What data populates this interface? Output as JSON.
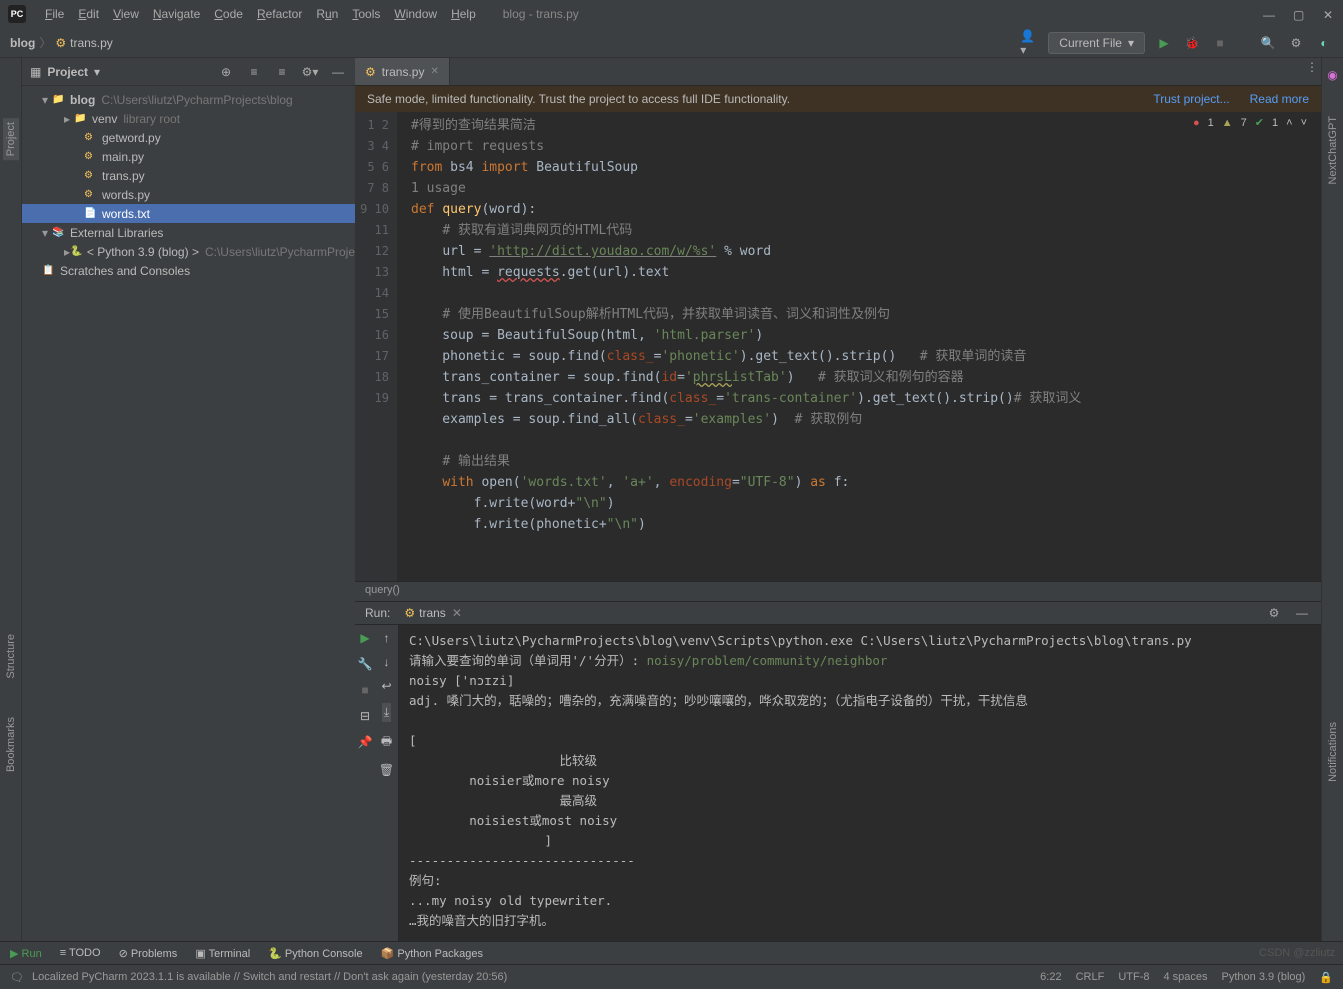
{
  "window": {
    "title": "blog - trans.py"
  },
  "menu": {
    "file": "File",
    "edit": "Edit",
    "view": "View",
    "navigate": "Navigate",
    "code": "Code",
    "refactor": "Refactor",
    "run": "Run",
    "tools": "Tools",
    "window": "Window",
    "help": "Help"
  },
  "breadcrumb": {
    "root": "blog",
    "file": "trans.py"
  },
  "runConfig": {
    "label": "Current File"
  },
  "projectPanel": {
    "title": "Project",
    "root": {
      "name": "blog",
      "path": "C:\\Users\\liutz\\PycharmProjects\\blog"
    },
    "venv": {
      "name": "venv",
      "hint": "library root"
    },
    "files": [
      "getword.py",
      "main.py",
      "trans.py",
      "words.py",
      "words.txt"
    ],
    "extLib": "External Libraries",
    "python": {
      "name": "< Python 3.9 (blog) >",
      "path": "C:\\Users\\liutz\\PycharmProje"
    },
    "scratches": "Scratches and Consoles"
  },
  "tab": {
    "name": "trans.py"
  },
  "banner": {
    "msg": "Safe mode, limited functionality. Trust the project to access full IDE functionality.",
    "trust": "Trust project...",
    "more": "Read more"
  },
  "inspections": {
    "errors": "1",
    "warnings": "7",
    "ok": "1"
  },
  "code": {
    "usage": "1 usage",
    "lines": [
      "1",
      "2",
      "3",
      "4",
      "5",
      "6",
      "7",
      "8",
      "9",
      "10",
      "11",
      "12",
      "13",
      "14",
      "15",
      "16",
      "17",
      "18",
      "19"
    ],
    "l1": "#得到的查询结果简洁",
    "l2": "# import requests",
    "l3_from": "from",
    "l3_bs4": "bs4",
    "l3_import": "import",
    "l3_bsoup": "BeautifulSoup",
    "l4_def": "def",
    "l4_fn": "query",
    "l4_param": "word",
    "l5": "# 获取有道词典网页的HTML代码",
    "l6_url": "url = ",
    "l6_str": "'http://dict.youdao.com/w/%s'",
    "l6_end": " % word",
    "l7": "html = requests.get(url).text",
    "l9": "# 使用BeautifulSoup解析HTML代码，并获取单词读音、词义和词性及例句",
    "l10": "soup = BeautifulSoup(html, 'html.parser')",
    "l11a": "phonetic = soup.find(",
    "l11b": "class_",
    "l11c": "='phonetic').get_text().strip()",
    "l11d": "   # 获取单词的读音",
    "l12a": "trans_container = soup.find(",
    "l12b": "id",
    "l12c": "='phrsListTab')",
    "l12d": "   # 获取词义和例句的容器",
    "l13a": "trans = trans_container.find(",
    "l13b": "class_",
    "l13c": "='trans-container').get_text().strip()",
    "l13d": "# 获取词义",
    "l14a": "examples = soup.find_all(",
    "l14b": "class_",
    "l14c": "='examples')",
    "l14d": "  # 获取例句",
    "l16": "# 输出结果",
    "l17a": "with",
    "l17b": "open",
    "l17c": "('words.txt', 'a+', ",
    "l17d": "encoding",
    "l17e": "=\"UTF-8\") ",
    "l17f": "as",
    "l17g": " f:",
    "l18": "f.write(word+\"\\n\")",
    "l19": "f.write(phonetic+\"\\n\")"
  },
  "breadcrumbBottom": "query()",
  "run": {
    "label": "Run:",
    "tab": "trans",
    "out1": "C:\\Users\\liutz\\PycharmProjects\\blog\\venv\\Scripts\\python.exe C:\\Users\\liutz\\PycharmProjects\\blog\\trans.py",
    "out2": "请输入要查询的单词（单词用'/'分开）: ",
    "out2b": "noisy/problem/community/neighbor",
    "out3": "noisy ['nɔɪzi]",
    "out4": "adj. 嗓门大的，聒噪的；嘈杂的，充满噪音的；吵吵嚷嚷的，哗众取宠的；（尤指电子设备的）干扰，干扰信息",
    "out5": "[",
    "out6": "                    比较级",
    "out7": "        noisier或more noisy",
    "out8": "                    最高级",
    "out9": "        noisiest或most noisy",
    "out10": "                  ]",
    "out11": "------------------------------",
    "out12": "例句:",
    "out13": "...my noisy old typewriter.",
    "out14": "…我的噪音大的旧打字机。"
  },
  "tools": {
    "run": "Run",
    "todo": "TODO",
    "problems": "Problems",
    "terminal": "Terminal",
    "pyconsole": "Python Console",
    "packages": "Python Packages"
  },
  "status": {
    "msg": "Localized PyCharm 2023.1.1 is available // Switch and restart // Don't ask again (yesterday 20:56)",
    "pos": "6:22",
    "eol": "CRLF",
    "enc": "UTF-8",
    "indent": "4 spaces",
    "interp": "Python 3.9 (blog)"
  },
  "sideLabels": {
    "project": "Project",
    "structure": "Structure",
    "bookmarks": "Bookmarks",
    "notifications": "Notifications",
    "nextchat": "NextChatGPT"
  },
  "watermark": "CSDN @zzliutz"
}
